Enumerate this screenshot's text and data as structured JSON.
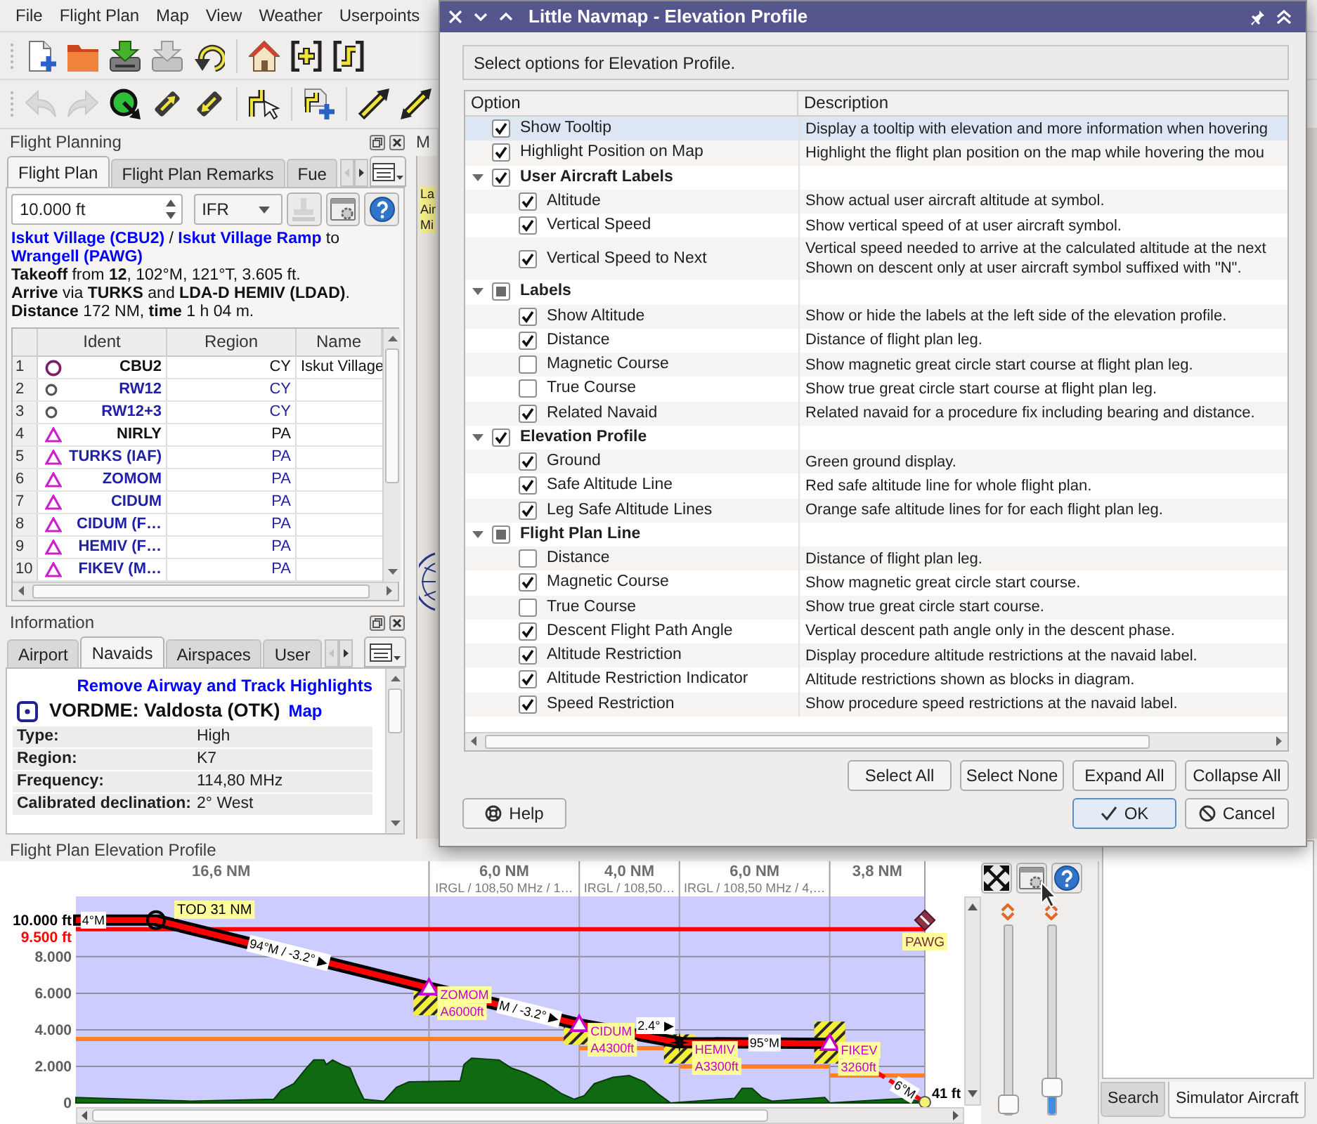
{
  "menu_bar": {
    "items": [
      "File",
      "Flight Plan",
      "Map",
      "View",
      "Weather",
      "Userpoints"
    ]
  },
  "toolbars": [
    [
      {
        "kind": "new",
        "disabled": false
      },
      {
        "kind": "open",
        "disabled": false
      },
      {
        "kind": "save",
        "disabled": false
      },
      {
        "kind": "save_as",
        "disabled": false
      },
      {
        "kind": "reload",
        "disabled": false
      },
      {
        "kind": "separator"
      },
      {
        "kind": "home",
        "disabled": false
      },
      {
        "kind": "zoom_in",
        "disabled": false
      },
      {
        "kind": "route",
        "disabled": false
      }
    ],
    [
      {
        "kind": "undo",
        "disabled": true
      },
      {
        "kind": "redo",
        "disabled": true
      },
      {
        "kind": "target",
        "disabled": false
      },
      {
        "kind": "move_up",
        "disabled": false
      },
      {
        "kind": "move_down",
        "disabled": false
      },
      {
        "kind": "separator"
      },
      {
        "kind": "edit_route",
        "disabled": false
      },
      {
        "kind": "separator"
      },
      {
        "kind": "add_route",
        "disabled": false
      },
      {
        "kind": "separator"
      },
      {
        "kind": "arrow_a",
        "disabled": false
      },
      {
        "kind": "arrow_b",
        "disabled": false
      }
    ]
  ],
  "flight_planning": {
    "title": "Flight Planning",
    "tabs": [
      {
        "label": "Flight Plan",
        "selected": true
      },
      {
        "label": "Flight Plan Remarks",
        "selected": false
      },
      {
        "label": "Fue",
        "selected": false
      }
    ],
    "altitude": {
      "value": "10.000 ft"
    },
    "flight_rules": {
      "value": "IFR"
    },
    "tool_buttons": [
      {
        "kind": "stamp",
        "disabled": true
      },
      {
        "kind": "settings",
        "disabled": false
      },
      {
        "kind": "help",
        "disabled": false
      }
    ],
    "route_links": [
      {
        "kind": "link",
        "text": "Iskut Village (CBU2)"
      },
      {
        "kind": "text",
        "text": " / "
      },
      {
        "kind": "link",
        "text": "Iskut Village Ramp"
      },
      {
        "kind": "text",
        "text": " to "
      },
      {
        "kind": "link",
        "text": "Wrangell (PAWG)"
      }
    ],
    "route_details": [
      "**Takeoff** from **12**, 102°M, 121°T, 3.605 ft.",
      "**Arrive** via **TURKS** and **LDA-D HEMIV (LDAD)**.",
      "**Distance** 172 NM, **time** 1 h 04 m."
    ],
    "table": {
      "columns": [
        "Ident",
        "Region",
        "Name"
      ],
      "rows": [
        {
          "number": "1",
          "kind": "airport",
          "procedure": false,
          "ident": "CBU2",
          "region": "CY",
          "name": "Iskut Village"
        },
        {
          "number": "2",
          "kind": "runway",
          "procedure": true,
          "ident": "RW12",
          "region": "CY"
        },
        {
          "number": "3",
          "kind": "runway",
          "procedure": true,
          "ident": "RW12+3",
          "region": "CY"
        },
        {
          "number": "4",
          "kind": "waypoint",
          "procedure": false,
          "ident": "NIRLY",
          "region": "PA"
        },
        {
          "number": "5",
          "kind": "waypoint",
          "procedure": true,
          "ident": "TURKS (IAF)",
          "region": "PA"
        },
        {
          "number": "6",
          "kind": "waypoint",
          "procedure": true,
          "ident": "ZOMOM",
          "region": "PA"
        },
        {
          "number": "7",
          "kind": "waypoint",
          "procedure": true,
          "ident": "CIDUM",
          "region": "PA"
        },
        {
          "number": "8",
          "kind": "waypoint",
          "procedure": true,
          "ident": "CIDUM (F…",
          "region": "PA"
        },
        {
          "number": "9",
          "kind": "waypoint",
          "procedure": true,
          "ident": "HEMIV (F…",
          "region": "PA"
        },
        {
          "number": "10",
          "kind": "waypoint",
          "procedure": true,
          "ident": "FIKEV (M…",
          "region": "PA"
        }
      ]
    }
  },
  "information": {
    "title": "Information",
    "tabs": [
      {
        "label": "Airport",
        "selected": false
      },
      {
        "label": "Navaids",
        "selected": true
      },
      {
        "label": "Airspaces",
        "selected": false
      },
      {
        "label": "User",
        "selected": false
      }
    ],
    "link": "Remove Airway and Track Highlights",
    "heading": "VORDME: Valdosta (OTK)",
    "map_link": "Map",
    "fields": [
      {
        "label": "Type:",
        "value": "High"
      },
      {
        "label": "Region:",
        "value": "K7"
      },
      {
        "label": "Frequency:",
        "value": "114,80 MHz"
      },
      {
        "label": "Calibrated declination:",
        "value": "2° West"
      }
    ]
  },
  "map_dock": {
    "title": "M",
    "label_lines": [
      "La",
      "Air",
      "Mi"
    ]
  },
  "elevation_profile": {
    "title": "Flight Plan Elevation Profile",
    "legs": [
      {
        "distance": "16,6 NM"
      },
      {
        "distance": "6,0 NM",
        "navaid": "IRGL / 108,50 MHz / 1…"
      },
      {
        "distance": "4,0 NM",
        "navaid": "IRGL / 108,50…"
      },
      {
        "distance": "6,0 NM",
        "navaid": "IRGL / 108,50 MHz / 4,…"
      },
      {
        "distance": "3,8 NM"
      }
    ],
    "altitude_labels": [
      {
        "label": "10.000 ft",
        "color": "#000000"
      },
      {
        "label": "9.500 ft",
        "color": "#ff0000"
      }
    ],
    "axis_labels": [
      "8.000",
      "6.000",
      "4.000",
      "2.000",
      "0"
    ],
    "top_of_descent": "TOD 31 NM",
    "course_labels": [
      "4°M",
      "94°M / -3.2° ▶",
      "M / -3.2° ▶",
      "2.4° ▶",
      "95°M",
      "6°M"
    ],
    "waypoints": [
      {
        "kind": "triangle",
        "label": "ZOMOM",
        "restriction": "A6000ft"
      },
      {
        "kind": "triangle",
        "label": "CIDUM",
        "restriction": "A4300ft"
      },
      {
        "kind": "star",
        "label": "HEMIV",
        "restriction": "A3300ft"
      },
      {
        "kind": "triangle",
        "label": "FIKEV",
        "restriction": "3260ft"
      }
    ],
    "destination": "PAWG",
    "end_altitude": "41 ft"
  },
  "side_controls": {
    "buttons": [
      {
        "kind": "expand"
      },
      {
        "kind": "settings"
      },
      {
        "kind": "help"
      }
    ],
    "sliders": [
      {
        "level": 0
      },
      {
        "level": 0.1
      }
    ]
  },
  "bottom_tabs": [
    {
      "label": "Search",
      "selected": false
    },
    {
      "label": "Simulator Aircraft",
      "selected": true
    }
  ],
  "dialog": {
    "title": "Little Navmap - Elevation Profile",
    "message": "Select options for Elevation Profile.",
    "columns": [
      "Option",
      "Description"
    ],
    "items": [
      {
        "label": "Show Tooltip",
        "description": "Display a tooltip with elevation and more information when hovering",
        "checked": true,
        "partial": false,
        "selected": true
      },
      {
        "label": "Highlight Position on Map",
        "description": "Highlight the flight plan position on the map while hovering the mou",
        "checked": true,
        "partial": false,
        "selected": false
      },
      {
        "label": "User Aircraft Labels",
        "checked": true,
        "partial": false,
        "selected": false,
        "expanded": true,
        "children": [
          {
            "label": "Altitude",
            "description": "Show actual user aircraft altitude at symbol.",
            "checked": true,
            "selected": false
          },
          {
            "label": "Vertical Speed",
            "description": "Show vertical speed of at user aircraft symbol.",
            "checked": true,
            "selected": false
          },
          {
            "label": "Vertical Speed to Next",
            "description": "Vertical speed needed to arrive at the calculated altitude at the next\nShown on descent only at user aircraft symbol suffixed with \"N\".",
            "checked": true,
            "selected": false
          }
        ]
      },
      {
        "label": "Labels",
        "checked": false,
        "partial": true,
        "selected": false,
        "expanded": true,
        "children": [
          {
            "label": "Show Altitude",
            "description": "Show or hide the labels at the left side of the elevation profile.",
            "checked": true,
            "selected": false
          },
          {
            "label": "Distance",
            "description": "Distance of flight plan leg.",
            "checked": true,
            "selected": false
          },
          {
            "label": "Magnetic Course",
            "description": "Show magnetic great circle start course at flight plan leg.",
            "checked": false,
            "selected": false
          },
          {
            "label": "True Course",
            "description": "Show true great circle start course at flight plan leg.",
            "checked": false,
            "selected": false
          },
          {
            "label": "Related Navaid",
            "description": "Related navaid for a procedure fix including bearing and distance.",
            "checked": true,
            "selected": false
          }
        ]
      },
      {
        "label": "Elevation Profile",
        "checked": true,
        "partial": false,
        "selected": false,
        "expanded": true,
        "children": [
          {
            "label": "Ground",
            "description": "Green ground display.",
            "checked": true,
            "selected": false
          },
          {
            "label": "Safe Altitude Line",
            "description": "Red safe altitude line for whole flight plan.",
            "checked": true,
            "selected": false
          },
          {
            "label": "Leg Safe Altitude Lines",
            "description": "Orange safe altitude lines for for each flight plan leg.",
            "checked": true,
            "selected": false
          }
        ]
      },
      {
        "label": "Flight Plan Line",
        "checked": false,
        "partial": true,
        "selected": false,
        "expanded": true,
        "children": [
          {
            "label": "Distance",
            "description": "Distance of flight plan leg.",
            "checked": false,
            "selected": false
          },
          {
            "label": "Magnetic Course",
            "description": "Show magnetic great circle start course.",
            "checked": true,
            "selected": false
          },
          {
            "label": "True Course",
            "description": "Show true great circle start course.",
            "checked": false,
            "selected": false
          },
          {
            "label": "Descent Flight Path Angle",
            "description": "Vertical descent path angle only in the descent phase.",
            "checked": true,
            "selected": false
          },
          {
            "label": "Altitude Restriction",
            "description": "Display procedure altitude restrictions at the navaid label.",
            "checked": true,
            "selected": false
          },
          {
            "label": "Altitude Restriction Indicator",
            "description": "Altitude restrictions shown as blocks in diagram.",
            "checked": true,
            "selected": false
          },
          {
            "label": "Speed Restriction",
            "description": "Show procedure speed restrictions at the navaid label.",
            "checked": true,
            "selected": false
          }
        ]
      }
    ],
    "tree_buttons": [
      "Select All",
      "Select None",
      "Expand All",
      "Collapse All"
    ],
    "buttons": [
      {
        "kind": "help",
        "label": "Help",
        "default": false
      },
      {
        "kind": "ok",
        "label": "OK",
        "default": true
      },
      {
        "kind": "cancel",
        "label": "Cancel",
        "default": false
      }
    ]
  }
}
